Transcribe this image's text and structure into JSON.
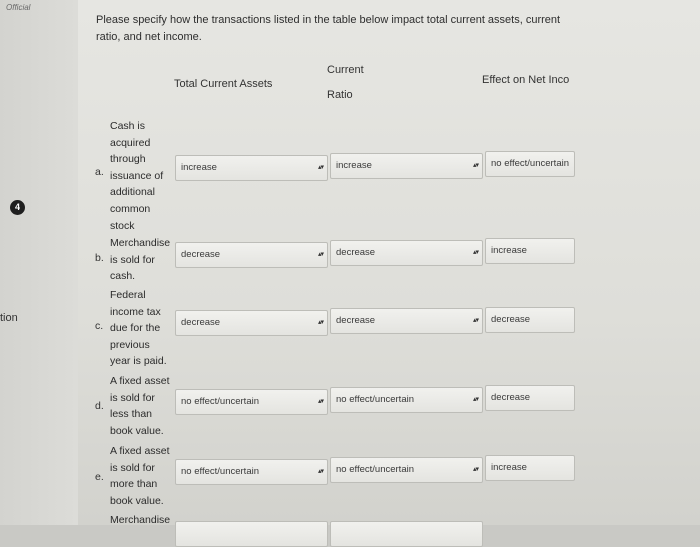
{
  "header": {
    "official_label": "Official"
  },
  "left": {
    "badge": "4",
    "side_text": "tion"
  },
  "question": "Please specify how the transactions listed in the table below impact total current assets, current ratio, and net income.",
  "columns": {
    "total_current_assets": "Total Current Assets",
    "current_ratio_line1": "Current",
    "current_ratio_line2": "Ratio",
    "net_income": "Effect on Net Inco"
  },
  "rows": [
    {
      "letter": "a.",
      "lines": [
        "Cash is",
        "acquired",
        "through",
        "issuance of",
        "additional",
        "common",
        "stock"
      ],
      "tca": "increase",
      "cr": "increase",
      "ni": "no effect/uncertain"
    },
    {
      "letter": "b.",
      "lines": [
        "Merchandise",
        "is sold for",
        "cash."
      ],
      "tca": "decrease",
      "cr": "decrease",
      "ni": "increase"
    },
    {
      "letter": "c.",
      "lines": [
        "Federal",
        "income tax",
        "due for the",
        "previous",
        "year is paid."
      ],
      "tca": "decrease",
      "cr": "decrease",
      "ni": "decrease"
    },
    {
      "letter": "d.",
      "lines": [
        "A fixed asset",
        "is sold for",
        "less than",
        "book value."
      ],
      "tca": "no effect/uncertain",
      "cr": "no effect/uncertain",
      "ni": "decrease"
    },
    {
      "letter": "e.",
      "lines": [
        "A fixed asset",
        "is sold for",
        "more than",
        "book value."
      ],
      "tca": "no effect/uncertain",
      "cr": "no effect/uncertain",
      "ni": "increase"
    },
    {
      "letter": "",
      "lines": [
        "Merchandise"
      ],
      "tca": "",
      "cr": "",
      "ni": ""
    }
  ],
  "icons": {
    "select_arrows": "up-down-arrows-icon"
  }
}
